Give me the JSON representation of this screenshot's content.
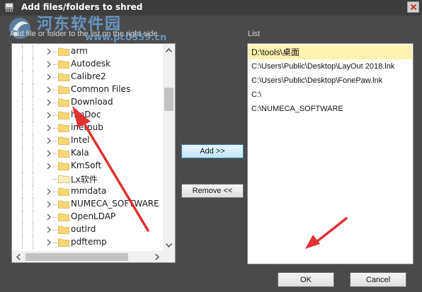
{
  "window": {
    "title": "Add files/folders to shred",
    "close_glyph": "×"
  },
  "watermark": {
    "cn_text": "河东软件园",
    "url": "www.pc0359.cn"
  },
  "left_panel": {
    "hint": "Add file or folder to the list on the right side",
    "tree_items": [
      {
        "label": "arm",
        "expandable": true
      },
      {
        "label": "Autodesk",
        "expandable": true
      },
      {
        "label": "Calibre2",
        "expandable": true
      },
      {
        "label": "Common Files",
        "expandable": true
      },
      {
        "label": "Download",
        "expandable": true
      },
      {
        "label": "hmDoc",
        "expandable": true
      },
      {
        "label": "inetpub",
        "expandable": true
      },
      {
        "label": "Intel",
        "expandable": true
      },
      {
        "label": "Kala",
        "expandable": true
      },
      {
        "label": "KmSoft",
        "expandable": true
      },
      {
        "label": "Lx软件",
        "expandable": false
      },
      {
        "label": "mmdata",
        "expandable": true
      },
      {
        "label": "NUMECA_SOFTWARE",
        "expandable": true
      },
      {
        "label": "OpenLDAP",
        "expandable": true
      },
      {
        "label": "outlrd",
        "expandable": true
      },
      {
        "label": "pdftemp",
        "expandable": true
      }
    ]
  },
  "buttons": {
    "add": "Add >>",
    "remove": "Remove <<",
    "ok": "OK",
    "cancel": "Cancel"
  },
  "right_panel": {
    "label": "List",
    "items": [
      {
        "path": "D:\\tools\\桌面",
        "selected": true
      },
      {
        "path": "C:\\Users\\Public\\Desktop\\LayOut 2018.lnk",
        "selected": false
      },
      {
        "path": "C:\\Users\\Public\\Desktop\\FonePaw.lnk",
        "selected": false
      },
      {
        "path": "C:\\",
        "selected": false
      },
      {
        "path": "C:\\NUMECA_SOFTWARE",
        "selected": false
      }
    ]
  },
  "colors": {
    "dialog_bg": "#4a4a4a",
    "folder_yellow": "#f7d774",
    "selected_row": "#fff2b0",
    "annotation_arrow": "#e03030",
    "add_button_accent": "#bee6fd"
  },
  "icons": [
    "shredder-icon",
    "close-icon",
    "watermark-logo-icon",
    "folder-icon",
    "chevron-right-icon",
    "scroll-up-icon",
    "scroll-down-icon",
    "scroll-left-icon",
    "scroll-right-icon",
    "annotation-arrow"
  ]
}
